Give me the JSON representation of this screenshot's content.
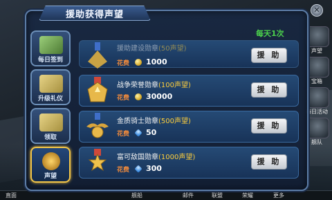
{
  "panel": {
    "title": "援助获得声望",
    "daily_limit": "每天1次",
    "close_icon": "close-icon"
  },
  "tabs": [
    {
      "label": "每日签到",
      "icon": "money-stack-icon"
    },
    {
      "label": "升级礼仪",
      "icon": "gift-icon"
    },
    {
      "label": "领取",
      "icon": "cash-bundle-icon"
    },
    {
      "label": "声望",
      "icon": "medal-icon",
      "active": true
    }
  ],
  "rows": [
    {
      "name": "援助建设勋章",
      "reputation": "(50声望)",
      "cost_label": "花费",
      "cost_type": "gold",
      "cost_value": "1000",
      "button": "援 助"
    },
    {
      "name": "战争荣誉勋章",
      "reputation": "(100声望)",
      "cost_label": "花费",
      "cost_type": "gold",
      "cost_value": "30000",
      "button": "援 助"
    },
    {
      "name": "金质骑士勋章",
      "reputation": "(500声望)",
      "cost_label": "花费",
      "cost_type": "gem",
      "cost_value": "50",
      "button": "援 助"
    },
    {
      "name": "富可敌国勋章",
      "reputation": "(1000声望)",
      "cost_label": "花费",
      "cost_type": "gem",
      "cost_value": "300",
      "button": "援 助"
    }
  ],
  "bottom_bar": [
    "直面",
    "舰船",
    "邮件",
    "联盟",
    "荣耀",
    "更多"
  ],
  "hud_right": [
    "声望",
    "宝箱",
    "每日活动",
    "舰队"
  ],
  "colors": {
    "accent": "#f2c548",
    "daily": "#4cd24c",
    "reputation": "#ffcf3c",
    "cost_label": "#f08a3c"
  }
}
